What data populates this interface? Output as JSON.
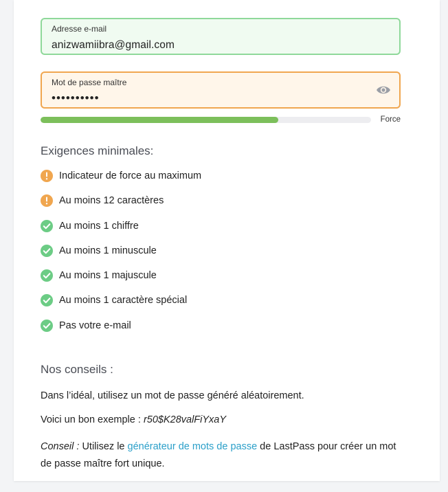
{
  "email": {
    "label": "Adresse e-mail",
    "value": "anizwamiibra@gmail.com"
  },
  "password": {
    "label": "Mot de passe maître",
    "value": "••••••••••",
    "toggle_icon": "eye-icon"
  },
  "strength": {
    "label": "Force",
    "level_fraction": 0.72,
    "color": "#7cbf5b"
  },
  "requirements": {
    "heading": "Exigences minimales:",
    "items": [
      {
        "label": "Indicateur de force au maximum",
        "status": "warning"
      },
      {
        "label": "Au moins 12 caractères",
        "status": "warning"
      },
      {
        "label": "Au moins 1 chiffre",
        "status": "ok"
      },
      {
        "label": "Au moins 1 minuscule",
        "status": "ok"
      },
      {
        "label": "Au moins 1 majuscule",
        "status": "ok"
      },
      {
        "label": "Au moins 1 caractère spécial",
        "status": "ok"
      },
      {
        "label": "Pas votre e-mail",
        "status": "ok"
      }
    ]
  },
  "advice": {
    "heading": "Nos conseils :",
    "ideal": "Dans l’idéal, utilisez un mot de passe généré aléatoirement.",
    "example_prefix": "Voici un bon exemple : ",
    "example": "r50$K28valFiYxaY",
    "tip_label": "Conseil :",
    "tip_before": " Utilisez le ",
    "tip_link": "générateur de mots de passe",
    "tip_after": " de LastPass pour créer un mot de passe maître fort unique."
  },
  "colors": {
    "email_border": "#8fd89a",
    "password_border": "#f0a64f",
    "warning": "#f0a64f",
    "ok": "#6ccc85",
    "link": "#2a9fc9"
  }
}
